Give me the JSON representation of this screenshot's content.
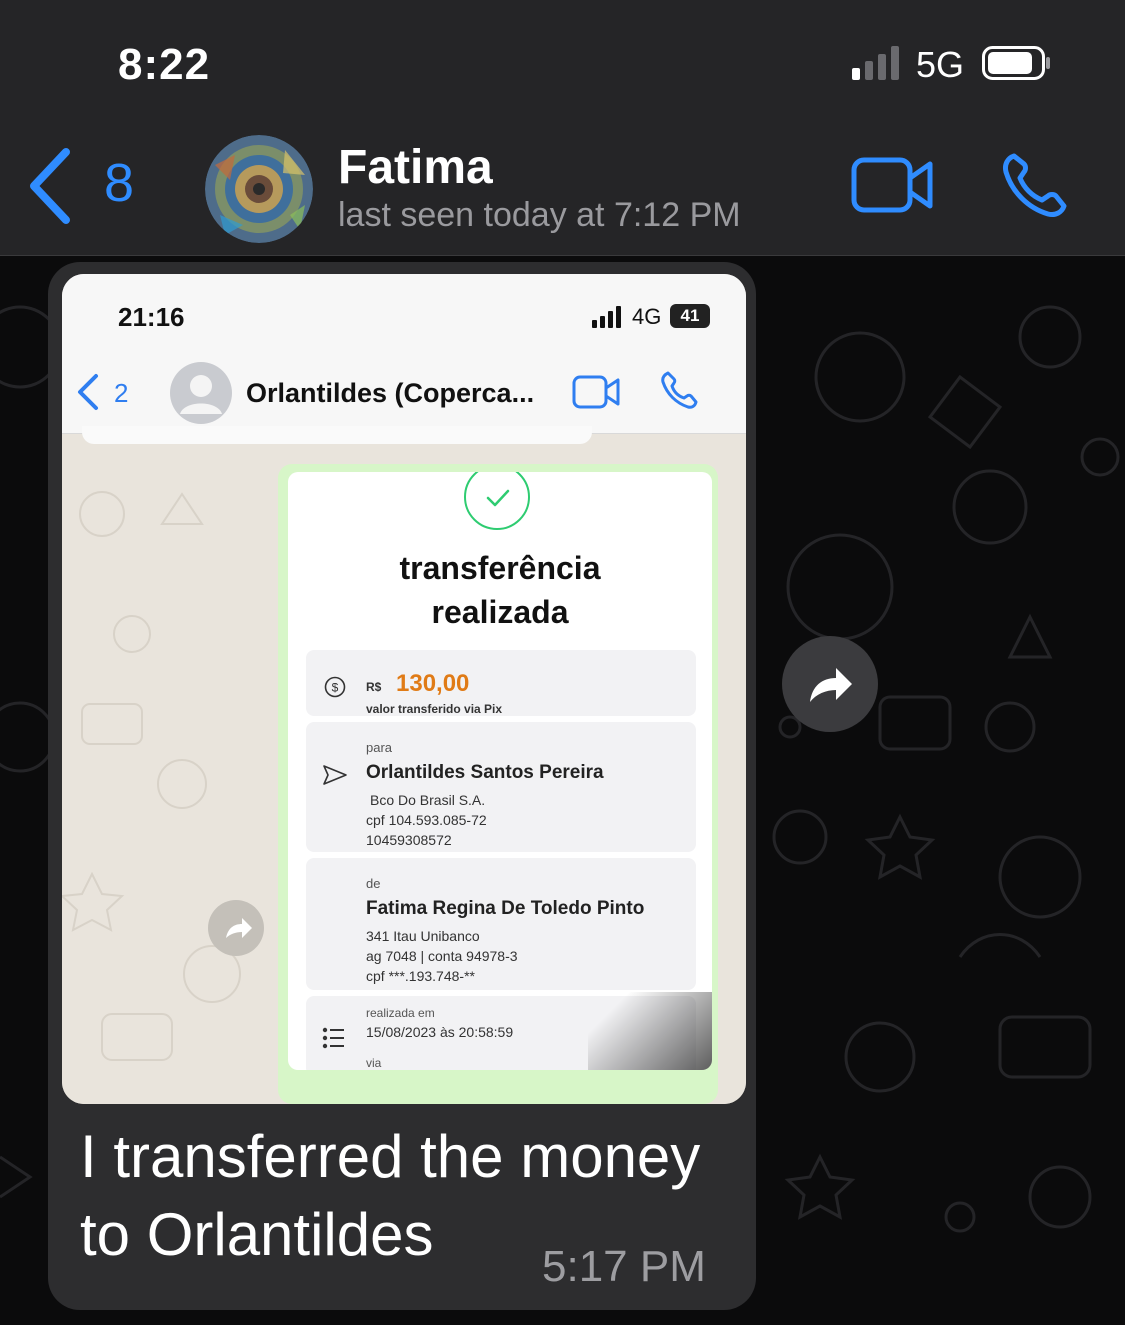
{
  "status_bar": {
    "time": "8:22",
    "network": "5G"
  },
  "header": {
    "back_count": "8",
    "contact_name": "Fatima",
    "last_seen": "last seen today at 7:12 PM"
  },
  "message": {
    "caption": "I transferred the money to Orlantildes",
    "time": "5:17 PM",
    "screenshot": {
      "status_time": "21:16",
      "status_network": "4G",
      "battery": "41",
      "back_count": "2",
      "contact_name": "Orlantildes (Coperca...",
      "receipt": {
        "title_line1": "transferência",
        "title_line2": "realizada",
        "currency": "R$",
        "amount": "130,00",
        "amount_note": "valor transferido via Pix",
        "to_label": "para",
        "to_name": "Orlantildes Santos Pereira",
        "to_bank": "Bco Do Brasil S.A.",
        "to_cpf": "cpf 104.593.085-72",
        "to_account": "10459308572",
        "from_label": "de",
        "from_name": "Fatima Regina De Toledo Pinto",
        "from_bank": "341 Itau Unibanco",
        "from_agency": "ag 7048 | conta 94978-3",
        "from_cpf": "cpf ***.193.748-**",
        "date_label": "realizada em",
        "date_value": "15/08/2023 às 20:58:59",
        "via_label": "via"
      }
    }
  },
  "colors": {
    "accent": "#2f8cff",
    "header_bg": "#252527",
    "bubble_bg": "#2d2d2f",
    "amount": "#e07b16",
    "check": "#2ecc71"
  },
  "icons": [
    "chevron-left-icon",
    "video-camera-icon",
    "phone-icon",
    "forward-icon",
    "check-icon"
  ]
}
